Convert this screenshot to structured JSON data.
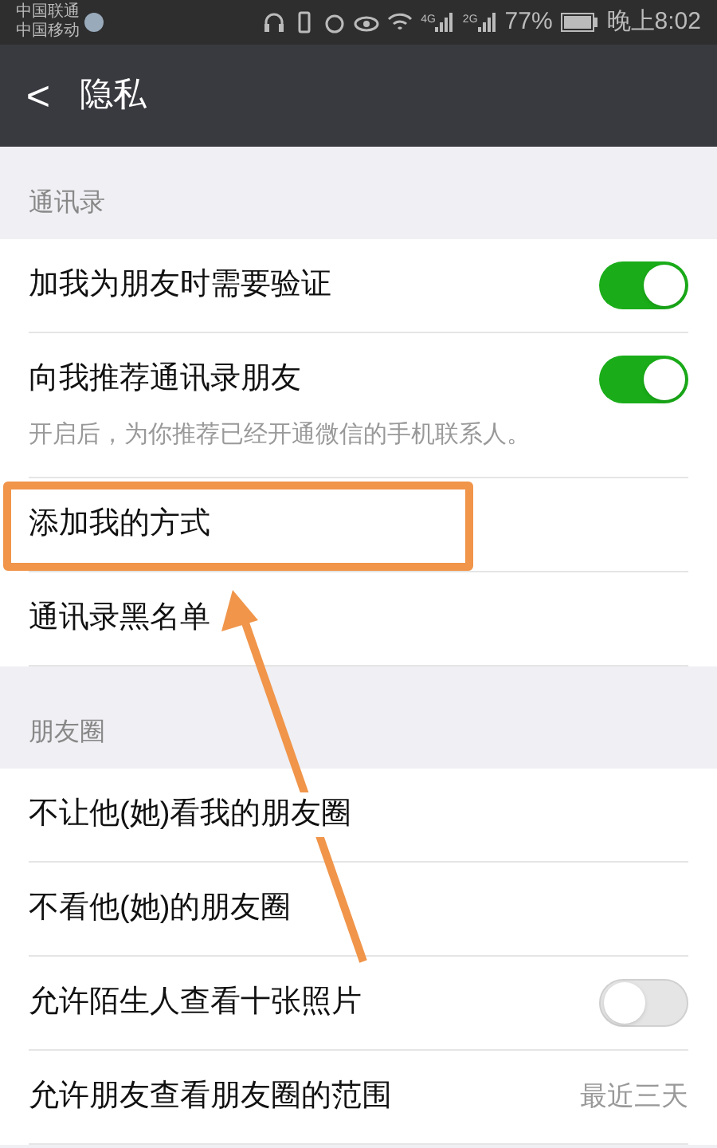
{
  "status_bar": {
    "carriers": [
      "中国联通",
      "中国移动"
    ],
    "network_labels": [
      "4G",
      "2G"
    ],
    "battery": "77%",
    "time": "晚上8:02"
  },
  "header": {
    "back": "<",
    "title": "隐私"
  },
  "sections": [
    {
      "label": "通讯录",
      "items": [
        {
          "kind": "toggle",
          "label": "加我为朋友时需要验证",
          "on": true
        },
        {
          "kind": "toggle",
          "label": "向我推荐通讯录朋友",
          "on": true,
          "hint": "开启后，为你推荐已经开通微信的手机联系人。"
        },
        {
          "kind": "link",
          "label": "添加我的方式",
          "highlighted": true
        },
        {
          "kind": "link",
          "label": "通讯录黑名单"
        }
      ]
    },
    {
      "label": "朋友圈",
      "items": [
        {
          "kind": "link",
          "label": "不让他(她)看我的朋友圈"
        },
        {
          "kind": "link",
          "label": "不看他(她)的朋友圈"
        },
        {
          "kind": "toggle",
          "label": "允许陌生人查看十张照片",
          "on": false
        },
        {
          "kind": "value",
          "label": "允许朋友查看朋友圈的范围",
          "value": "最近三天"
        }
      ]
    }
  ],
  "annotation": {
    "arrow": true
  }
}
